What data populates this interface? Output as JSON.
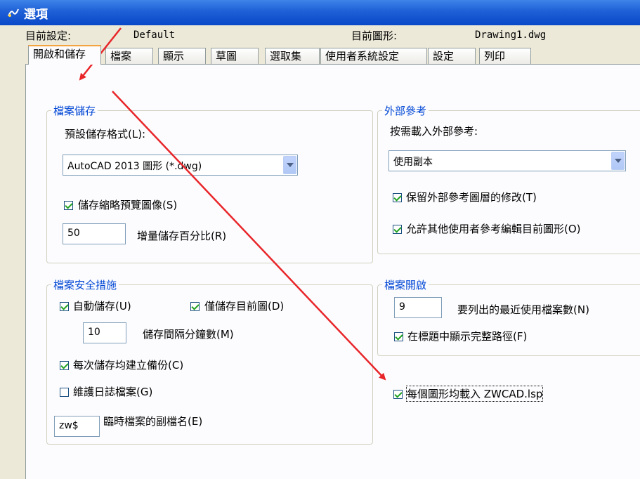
{
  "window": {
    "title": "選項"
  },
  "info": {
    "current_profile_label": "目前設定:",
    "current_profile_value": "Default",
    "current_drawing_label": "目前圖形:",
    "current_drawing_value": "Drawing1.dwg"
  },
  "tabs": [
    "開啟和儲存",
    "檔案",
    "顯示",
    "草圖",
    "選取集",
    "使用者系統設定",
    "設定",
    "列印"
  ],
  "file_save": {
    "title": "檔案儲存",
    "format_label": "預設儲存格式(L):",
    "format_value": "AutoCAD 2013 圖形 (*.dwg)",
    "thumbnail_label": "儲存縮略預覽圖像(S)",
    "thumbnail_checked": true,
    "incremental_value": "50",
    "incremental_label": "增量儲存百分比(R)"
  },
  "file_safety": {
    "title": "檔案安全措施",
    "autosave_label": "自動儲存(U)",
    "autosave_checked": true,
    "current_only_label": "僅儲存目前圖(D)",
    "current_only_checked": true,
    "interval_value": "10",
    "interval_label": "儲存間隔分鐘數(M)",
    "backup_label": "每次儲存均建立備份(C)",
    "backup_checked": true,
    "log_label": "維護日誌檔案(G)",
    "log_checked": false,
    "temp_ext_value": "zw$",
    "temp_ext_label": "臨時檔案的副檔名(E)"
  },
  "xref": {
    "title": "外部參考",
    "demand_label": "按需載入外部參考:",
    "demand_value": "使用副本",
    "retain_label": "保留外部參考圖層的修改(T)",
    "retain_checked": true,
    "allow_label": "允許其他使用者參考編輯目前圖形(O)",
    "allow_checked": true
  },
  "file_open": {
    "title": "檔案開啟",
    "recent_value": "9",
    "recent_label": "要列出的最近使用檔案數(N)",
    "fullpath_label": "在標題中顯示完整路徑(F)",
    "fullpath_checked": true
  },
  "load_lsp": {
    "label": "每個圖形均載入 ZWCAD.lsp",
    "checked": true
  },
  "colors": {
    "annotation_arrow": "#e8262a",
    "group_title": "#0046d5",
    "titlebar": "#0a48c8"
  }
}
